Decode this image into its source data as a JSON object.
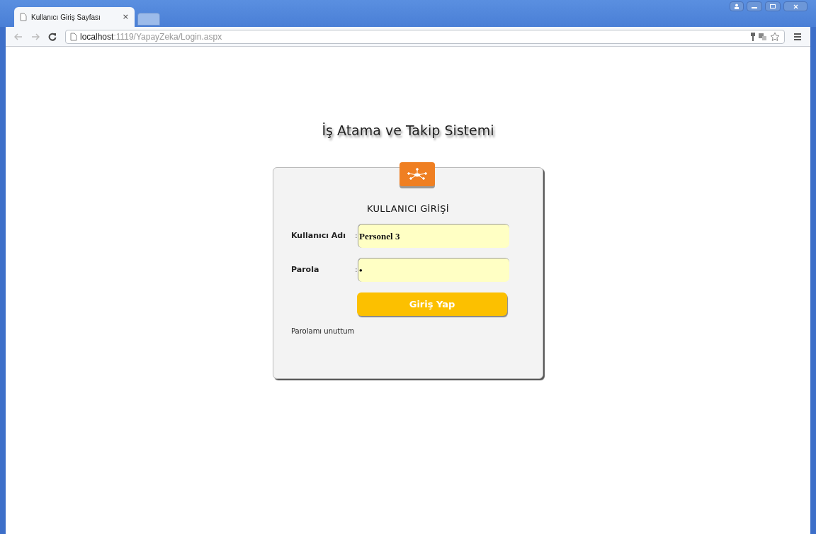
{
  "browser": {
    "tabs": [
      {
        "title": "Kullanıcı Giriş Sayfası",
        "close": "×",
        "selected": true
      }
    ],
    "address": {
      "host": "localhost",
      "path": ":1119/YapayZeka/Login.aspx"
    }
  },
  "page": {
    "title": "İş Atama ve Takip Sistemi",
    "login": {
      "heading": "KULLANICI GİRİŞİ",
      "fields": [
        {
          "label": "Kullanıcı Adı",
          "separator": ":",
          "value": "Personel 3"
        },
        {
          "label": "Parola",
          "separator": ":",
          "value": "•"
        }
      ],
      "button": "Giriş Yap",
      "forgot_link": "Parolamı unuttum"
    }
  }
}
